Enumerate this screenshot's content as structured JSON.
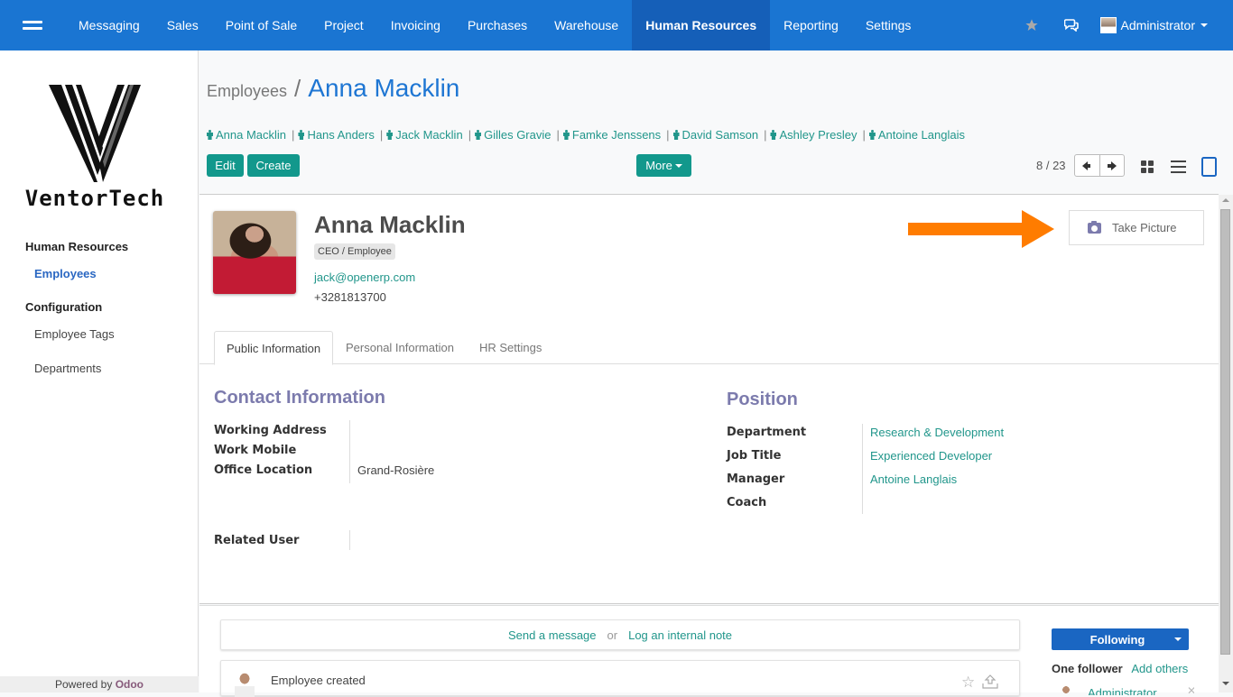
{
  "navbar": {
    "menu": [
      "Messaging",
      "Sales",
      "Point of Sale",
      "Project",
      "Invoicing",
      "Purchases",
      "Warehouse",
      "Human Resources",
      "Reporting",
      "Settings"
    ],
    "active": "Human Resources",
    "icons": [
      "star-icon",
      "chat-icon"
    ],
    "user": "Administrator"
  },
  "sidebar": {
    "logo_text": "VentorTech",
    "sections": [
      {
        "title": "Human Resources",
        "items": [
          {
            "label": "Employees",
            "active": true
          }
        ]
      },
      {
        "title": "Configuration",
        "items": [
          {
            "label": "Employee Tags",
            "active": false
          },
          {
            "label": "Departments",
            "active": false
          }
        ]
      }
    ],
    "powered_by": "Powered by",
    "powered_brand": "Odoo"
  },
  "control_panel": {
    "breadcrumb_parent": "Employees",
    "breadcrumb_sep": "/",
    "breadcrumb_current": "Anna Macklin",
    "employee_links": [
      "Anna Macklin",
      "Hans Anders",
      "Jack Macklin",
      "Gilles Gravie",
      "Famke Jenssens",
      "David Samson",
      "Ashley Presley",
      "Antoine Langlais"
    ],
    "edit_label": "Edit",
    "create_label": "Create",
    "more_label": "More",
    "pager": "8 / 23",
    "views": [
      "kanban-view-icon",
      "list-view-icon",
      "form-view-icon"
    ],
    "active_view": "form"
  },
  "employee": {
    "name": "Anna Macklin",
    "tag": "CEO / Employee",
    "email": "jack@openerp.com",
    "phone": "+3281813700",
    "take_picture_label": "Take Picture"
  },
  "annotation": {
    "arrow_color": "#ff7c00"
  },
  "tabs": [
    {
      "label": "Public Information",
      "active": true
    },
    {
      "label": "Personal Information",
      "active": false
    },
    {
      "label": "HR Settings",
      "active": false
    }
  ],
  "contact": {
    "title": "Contact Information",
    "fields": [
      {
        "label": "Working Address",
        "value": ""
      },
      {
        "label": "Work Mobile",
        "value": ""
      },
      {
        "label": "Office Location",
        "value": "Grand-Rosière"
      }
    ],
    "related_user_label": "Related User",
    "related_user_value": ""
  },
  "position": {
    "title": "Position",
    "fields": [
      {
        "label": "Department",
        "value": "Research & Development"
      },
      {
        "label": "Job Title",
        "value": "Experienced Developer"
      },
      {
        "label": "Manager",
        "value": "Antoine Langlais"
      },
      {
        "label": "Coach",
        "value": ""
      }
    ]
  },
  "chatter": {
    "send_message": "Send a message",
    "or": "or",
    "log_note": "Log an internal note",
    "message_text": "Employee created",
    "following_label": "Following",
    "followers_count": "One follower",
    "add_others": "Add others",
    "follower_name": "Administrator"
  },
  "colors": {
    "navbar": "#1a75d2",
    "primary_button": "#12988c",
    "link": "#21968b",
    "group_title": "#7c7bad",
    "breadcrumb_current": "#1e76d3",
    "following_button": "#1a66c2"
  }
}
